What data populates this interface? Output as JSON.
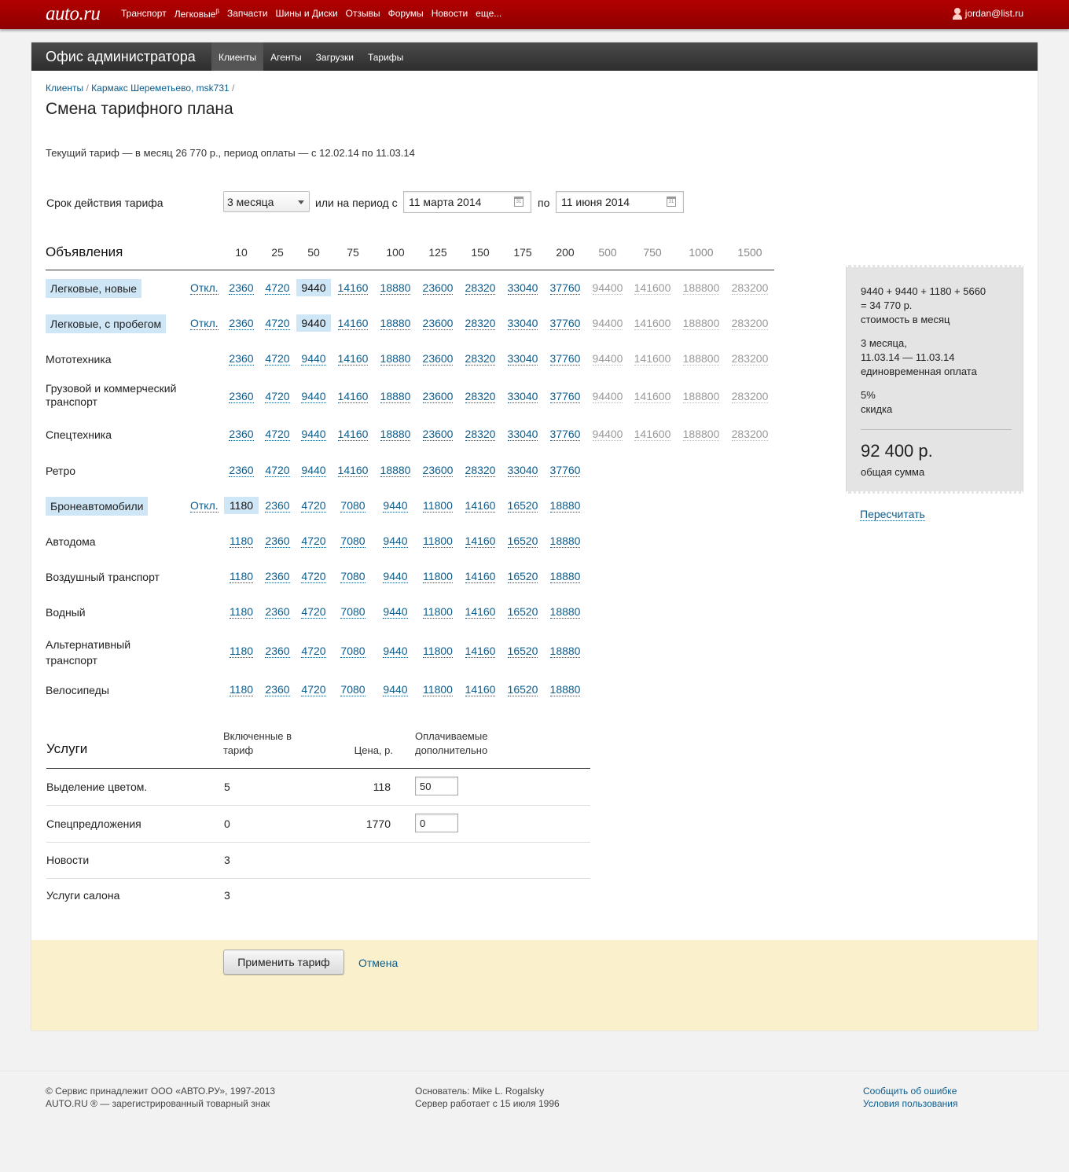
{
  "topbar": {
    "logo": "auto.ru",
    "nav": [
      "Транспорт",
      "Легковые",
      "Запчасти",
      "Шины и Диски",
      "Отзывы",
      "Форумы",
      "Новости",
      "еще..."
    ],
    "nav_beta": "β",
    "user": "jordan@list.ru"
  },
  "admin": {
    "title": "Офис администратора",
    "tabs": [
      "Клиенты",
      "Агенты",
      "Загрузки",
      "Тарифы"
    ],
    "active_tab": "Клиенты"
  },
  "breadcrumb": {
    "items": [
      "Клиенты",
      "Кармакс Шереметьево, msk731"
    ],
    "separator": "/"
  },
  "page_title": "Смена тарифного плана",
  "current_tariff": "Текущий тариф — в месяц 26 770 р., период оплаты — с 12.02.14 по 11.03.14",
  "period": {
    "label": "Срок действия тарифа",
    "select_value": "3 месяца",
    "or_label": "или на период с",
    "from": "11 марта 2014",
    "to_label": "по",
    "to": "11 июня 2014",
    "calendar_icon_text": "31"
  },
  "ads": {
    "header": "Объявления",
    "columns": [
      "10",
      "25",
      "50",
      "75",
      "100",
      "125",
      "150",
      "175",
      "200",
      "500",
      "750",
      "1000",
      "1500"
    ],
    "off_label": "Откл.",
    "rows": [
      {
        "label": "Легковые, новые",
        "highlight": true,
        "off": true,
        "selected": 2,
        "values": [
          "2360",
          "4720",
          "9440",
          "14160",
          "18880",
          "23600",
          "28320",
          "33040",
          "37760",
          "94400",
          "141600",
          "188800",
          "283200"
        ]
      },
      {
        "label": "Легковые, с пробегом",
        "highlight": true,
        "off": true,
        "selected": 2,
        "values": [
          "2360",
          "4720",
          "9440",
          "14160",
          "18880",
          "23600",
          "28320",
          "33040",
          "37760",
          "94400",
          "141600",
          "188800",
          "283200"
        ]
      },
      {
        "label": "Мототехника",
        "highlight": false,
        "off": false,
        "selected": -1,
        "values": [
          "2360",
          "4720",
          "9440",
          "14160",
          "18880",
          "23600",
          "28320",
          "33040",
          "37760",
          "94400",
          "141600",
          "188800",
          "283200"
        ]
      },
      {
        "label": "Грузовой и коммерческий транспорт",
        "highlight": false,
        "off": false,
        "selected": -1,
        "values": [
          "2360",
          "4720",
          "9440",
          "14160",
          "18880",
          "23600",
          "28320",
          "33040",
          "37760",
          "94400",
          "141600",
          "188800",
          "283200"
        ]
      },
      {
        "label": "Спецтехника",
        "highlight": false,
        "off": false,
        "selected": -1,
        "values": [
          "2360",
          "4720",
          "9440",
          "14160",
          "18880",
          "23600",
          "28320",
          "33040",
          "37760",
          "94400",
          "141600",
          "188800",
          "283200"
        ]
      },
      {
        "label": "Ретро",
        "highlight": false,
        "off": false,
        "selected": -1,
        "values": [
          "2360",
          "4720",
          "9440",
          "14160",
          "18880",
          "23600",
          "28320",
          "33040",
          "37760"
        ]
      },
      {
        "label": "Бронеавтомобили",
        "highlight": true,
        "off": true,
        "selected": 0,
        "values": [
          "1180",
          "2360",
          "4720",
          "7080",
          "9440",
          "11800",
          "14160",
          "16520",
          "18880"
        ]
      },
      {
        "label": "Автодома",
        "highlight": false,
        "off": false,
        "selected": -1,
        "values": [
          "1180",
          "2360",
          "4720",
          "7080",
          "9440",
          "11800",
          "14160",
          "16520",
          "18880"
        ]
      },
      {
        "label": "Воздушный транспорт",
        "highlight": false,
        "off": false,
        "selected": -1,
        "values": [
          "1180",
          "2360",
          "4720",
          "7080",
          "9440",
          "11800",
          "14160",
          "16520",
          "18880"
        ]
      },
      {
        "label": "Водный",
        "highlight": false,
        "off": false,
        "selected": -1,
        "values": [
          "1180",
          "2360",
          "4720",
          "7080",
          "9440",
          "11800",
          "14160",
          "16520",
          "18880"
        ]
      },
      {
        "label": "Альтернативный транспорт",
        "highlight": false,
        "off": false,
        "selected": -1,
        "values": [
          "1180",
          "2360",
          "4720",
          "7080",
          "9440",
          "11800",
          "14160",
          "16520",
          "18880"
        ]
      },
      {
        "label": "Велосипеды",
        "highlight": false,
        "off": false,
        "selected": -1,
        "values": [
          "1180",
          "2360",
          "4720",
          "7080",
          "9440",
          "11800",
          "14160",
          "16520",
          "18880"
        ]
      }
    ]
  },
  "services": {
    "header": "Услуги",
    "col_included": "Включенные в тариф",
    "col_price": "Цена, р.",
    "col_paid": "Оплачиваемые дополнительно",
    "rows": [
      {
        "name": "Выделение цветом.",
        "included": "5",
        "price": "118",
        "paid": "50"
      },
      {
        "name": "Спецпредложения",
        "included": "0",
        "price": "1770",
        "paid": "0"
      },
      {
        "name": "Новости",
        "included": "3",
        "price": "",
        "paid": null
      },
      {
        "name": "Услуги салона",
        "included": "3",
        "price": "",
        "paid": null
      }
    ]
  },
  "summary": {
    "formula": "9440 + 9440 + 1180 + 5660",
    "monthly": "= 34 770 р.",
    "monthly_label": "стоимость в месяц",
    "duration": "3 месяца,",
    "dates": "11.03.14 — 11.03.14",
    "payment_label": "единовременная оплата",
    "discount": "5%",
    "discount_label": "скидка",
    "total": "92 400 р.",
    "total_label": "общая сумма",
    "recalc": "Пересчитать"
  },
  "actions": {
    "apply": "Применить тариф",
    "cancel": "Отмена"
  },
  "footer": {
    "copyright": "© Сервис принадлежит ООО «АВТО.РУ», 1997-2013",
    "trademark": "AUTO.RU ® — зарегистрированный товарный знак",
    "founder": "Основатель: Mike L. Rogalsky",
    "server": "Сервер работает с 15 июля 1996",
    "report": "Сообщить об ошибке",
    "terms": "Условия пользования"
  },
  "colors": {
    "topbar": "#a00000",
    "link": "#0c5c8c",
    "highlight": "#cfe6f6",
    "action_bar": "#faf1cc"
  }
}
